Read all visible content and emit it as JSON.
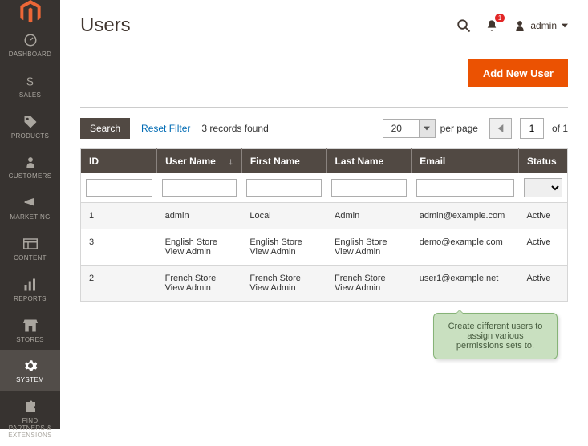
{
  "page": {
    "title": "Users"
  },
  "header": {
    "notification_count": "1",
    "user_label": "admin"
  },
  "actions": {
    "add_new": "Add New User"
  },
  "toolbar": {
    "search": "Search",
    "reset": "Reset Filter",
    "records": "3 records found",
    "page_size": "20",
    "per_page_label": "per page",
    "page_current": "1",
    "of_label": "of 1"
  },
  "columns": {
    "id": "ID",
    "username": "User Name",
    "firstname": "First Name",
    "lastname": "Last Name",
    "email": "Email",
    "status": "Status"
  },
  "rows": [
    {
      "id": "1",
      "username": "admin",
      "firstname": "Local",
      "lastname": "Admin",
      "email": "admin@example.com",
      "status": "Active"
    },
    {
      "id": "3",
      "username": "English Store View Admin",
      "firstname": "English Store View Admin",
      "lastname": "English Store View Admin",
      "email": "demo@example.com",
      "status": "Active"
    },
    {
      "id": "2",
      "username": "French Store View Admin",
      "firstname": "French Store View Admin",
      "lastname": "French Store View Admin",
      "email": "user1@example.net",
      "status": "Active"
    }
  ],
  "sidebar": {
    "items": [
      {
        "label": "DASHBOARD"
      },
      {
        "label": "SALES"
      },
      {
        "label": "PRODUCTS"
      },
      {
        "label": "CUSTOMERS"
      },
      {
        "label": "MARKETING"
      },
      {
        "label": "CONTENT"
      },
      {
        "label": "REPORTS"
      },
      {
        "label": "STORES"
      },
      {
        "label": "SYSTEM"
      },
      {
        "label": "FIND PARTNERS & EXTENSIONS"
      }
    ]
  },
  "tooltip": {
    "text": "Create different users to assign various permissions sets to."
  }
}
